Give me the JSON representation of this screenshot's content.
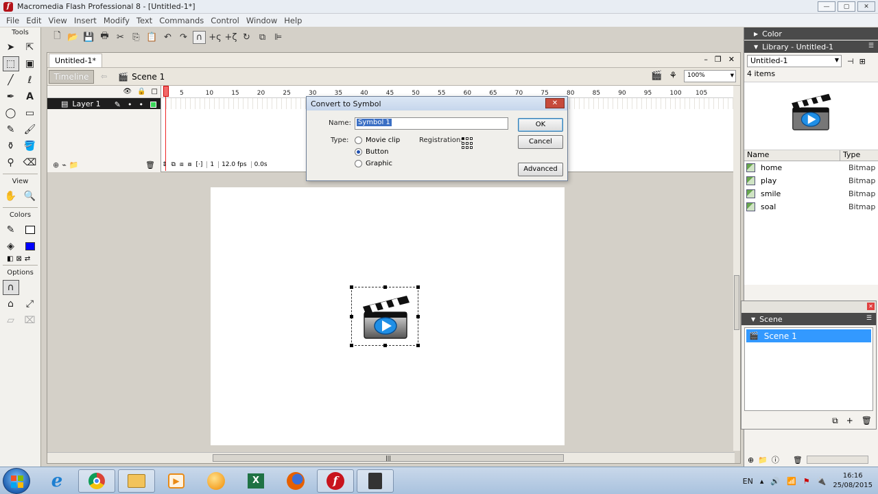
{
  "window": {
    "title": "Macromedia Flash Professional 8 - [Untitled-1*]",
    "min": "—",
    "max": "▢",
    "close": "✕"
  },
  "menu": [
    "File",
    "Edit",
    "View",
    "Insert",
    "Modify",
    "Text",
    "Commands",
    "Control",
    "Window",
    "Help"
  ],
  "tools": {
    "label_tools": "Tools",
    "label_view": "View",
    "label_colors": "Colors",
    "label_options": "Options",
    "stroke_color": "#000000",
    "fill_color": "#0000ff"
  },
  "document": {
    "tab": "Untitled-1*",
    "timeline_button": "Timeline",
    "scene": "Scene 1",
    "zoom": "100%",
    "win_min": "–",
    "win_restore": "❐",
    "win_close": "✕"
  },
  "timeline": {
    "layer": "Layer 1",
    "ruler": [
      "1",
      "5",
      "10",
      "15",
      "20",
      "25",
      "30",
      "35",
      "40",
      "45",
      "50",
      "55",
      "60",
      "65",
      "70",
      "75",
      "80",
      "85",
      "90",
      "95",
      "100",
      "105"
    ],
    "frame": "1",
    "fps": "12.0 fps",
    "time": "0.0s"
  },
  "dialog": {
    "title": "Convert to Symbol",
    "name_label": "Name:",
    "name_value": "Symbol 1",
    "type_label": "Type:",
    "types": [
      "Movie clip",
      "Button",
      "Graphic"
    ],
    "selected_type": "Button",
    "registration_label": "Registration:",
    "ok": "OK",
    "cancel": "Cancel",
    "advanced": "Advanced",
    "close": "✕"
  },
  "right_panels": {
    "color_header": "Color",
    "library_header": "Library - Untitled-1",
    "library_doc": "Untitled-1",
    "library_count": "4 items",
    "col_name": "Name",
    "col_type": "Type",
    "items": [
      {
        "name": "home",
        "type": "Bitmap"
      },
      {
        "name": "play",
        "type": "Bitmap"
      },
      {
        "name": "smile",
        "type": "Bitmap"
      },
      {
        "name": "soal",
        "type": "Bitmap"
      }
    ],
    "scene_header": "Scene",
    "scene_item": "Scene 1"
  },
  "taskbar": {
    "language": "EN",
    "time": "16:16",
    "date": "25/08/2015"
  }
}
